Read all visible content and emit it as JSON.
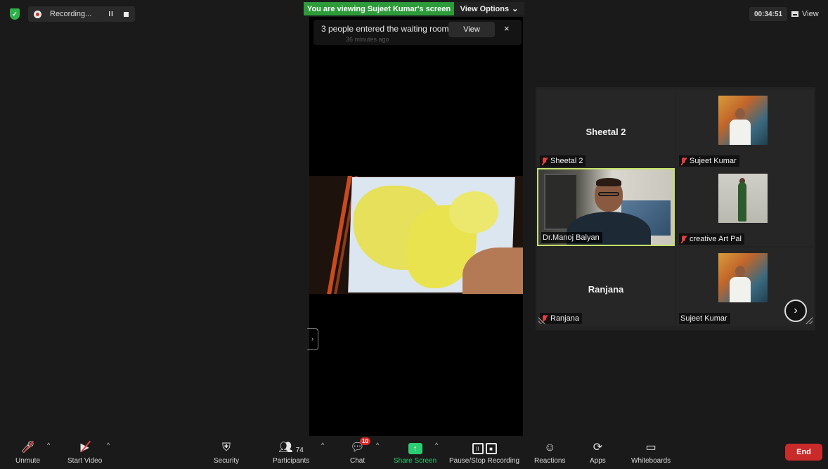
{
  "top": {
    "recording_label": "Recording...",
    "viewing_banner": "You are viewing Sujeet Kumar's screen",
    "view_options": "View Options",
    "timer": "00:34:51",
    "view_label": "View"
  },
  "notification": {
    "text": "3 people entered the waiting room",
    "subtext": "36 minutes ago",
    "view_button": "View",
    "close": "×"
  },
  "gallery": {
    "tiles": [
      {
        "name": "Sheetal 2",
        "display_name": "Sheetal 2"
      },
      {
        "name": "Sujeet Kumar"
      },
      {
        "name": "Dr.Manoj Balyan"
      },
      {
        "name": "creative Art Pal"
      },
      {
        "name": "Ranjana",
        "display_name": "Ranjana"
      },
      {
        "name": "Sujeet Kumar"
      }
    ],
    "next": "›"
  },
  "toolbar": {
    "unmute": "Unmute",
    "start_video": "Start Video",
    "security": "Security",
    "participants": "Participants",
    "participants_count": "74",
    "chat": "Chat",
    "chat_badge": "10",
    "share_screen": "Share Screen",
    "pause_stop_recording": "Pause/Stop Recording",
    "reactions": "Reactions",
    "apps": "Apps",
    "whiteboards": "Whiteboards",
    "end": "End"
  },
  "colors": {
    "share_green": "#2ecc71",
    "banner_green": "#2d9b3a",
    "end_red": "#c92a2a",
    "active_speaker": "#c6e06a"
  }
}
